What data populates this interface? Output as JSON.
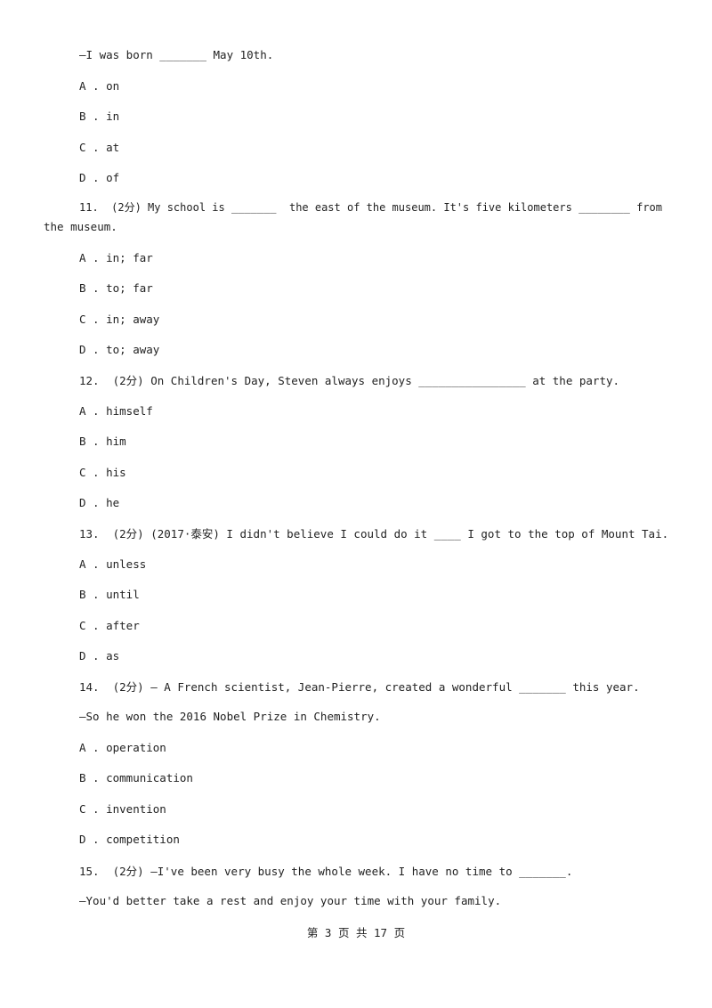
{
  "q10": {
    "stem_cont": "—I was born _______ May 10th.",
    "options": [
      "A . on",
      "B . in",
      "C . at",
      "D . of"
    ]
  },
  "q11": {
    "stem_line1": "11.  (2分) My school is _______  the east of the museum. It's five kilometers ________ from",
    "stem_line2": "the museum.",
    "options": [
      "A . in; far",
      "B . to; far",
      "C . in; away",
      "D . to; away"
    ]
  },
  "q12": {
    "stem": "12.  (2分) On Children's Day, Steven always enjoys ________________ at the party.",
    "options": [
      "A . himself",
      "B . him",
      "C . his",
      "D . he"
    ]
  },
  "q13": {
    "stem": "13.  (2分) (2017·泰安) I didn't believe I could do it ____ I got to the top of Mount Tai.",
    "options": [
      "A . unless",
      "B . until",
      "C . after",
      "D . as"
    ]
  },
  "q14": {
    "stem": "14.  (2分) — A French scientist, Jean-Pierre, created a wonderful _______ this year.",
    "stem_cont": "—So he won the 2016 Nobel Prize in Chemistry.",
    "options": [
      "A . operation",
      "B . communication",
      "C . invention",
      "D . competition"
    ]
  },
  "q15": {
    "stem": "15.  (2分) —I've been very busy the whole week. I have no time to _______.",
    "stem_cont": "—You'd better take a rest and enjoy your time with your family."
  },
  "footer": {
    "page_label": "第 3 页 共 17 页"
  }
}
